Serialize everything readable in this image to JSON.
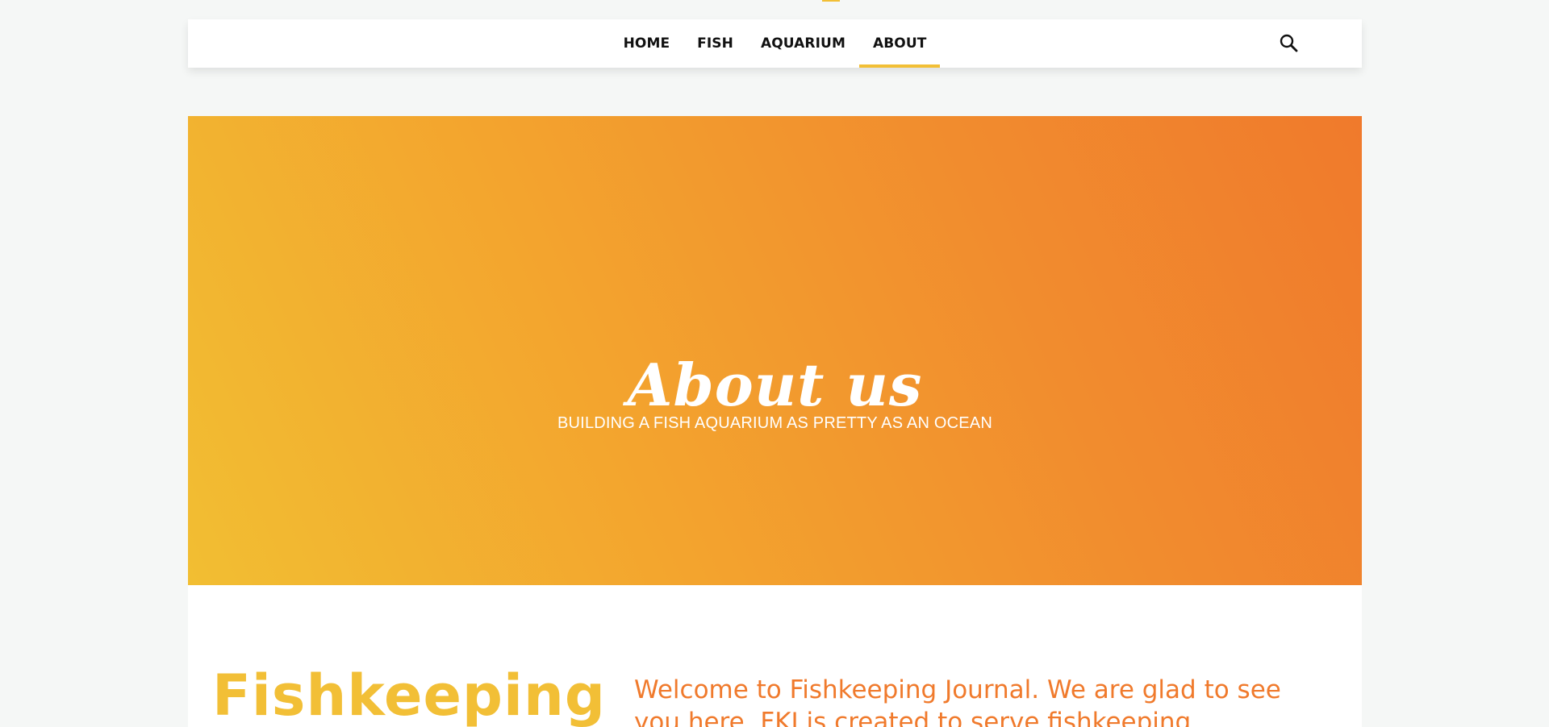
{
  "nav": {
    "items": [
      {
        "label": "HOME",
        "active": false
      },
      {
        "label": "FISH",
        "active": false
      },
      {
        "label": "AQUARIUM",
        "active": false
      },
      {
        "label": "ABOUT",
        "active": true
      }
    ],
    "search_icon": "search-icon"
  },
  "hero": {
    "title": "About us",
    "subtitle": "BUILDING A FISH AQUARIUM AS PRETTY AS AN OCEAN"
  },
  "content": {
    "heading": "Fishkeeping",
    "intro": "Welcome to Fishkeeping Journal. We are glad to see you here. FKJ is created to serve fishkeeping"
  },
  "colors": {
    "accent_yellow": "#f2bf36",
    "accent_orange": "#f07a2c",
    "nav_text": "#111111",
    "page_background": "#f5f7f6"
  }
}
